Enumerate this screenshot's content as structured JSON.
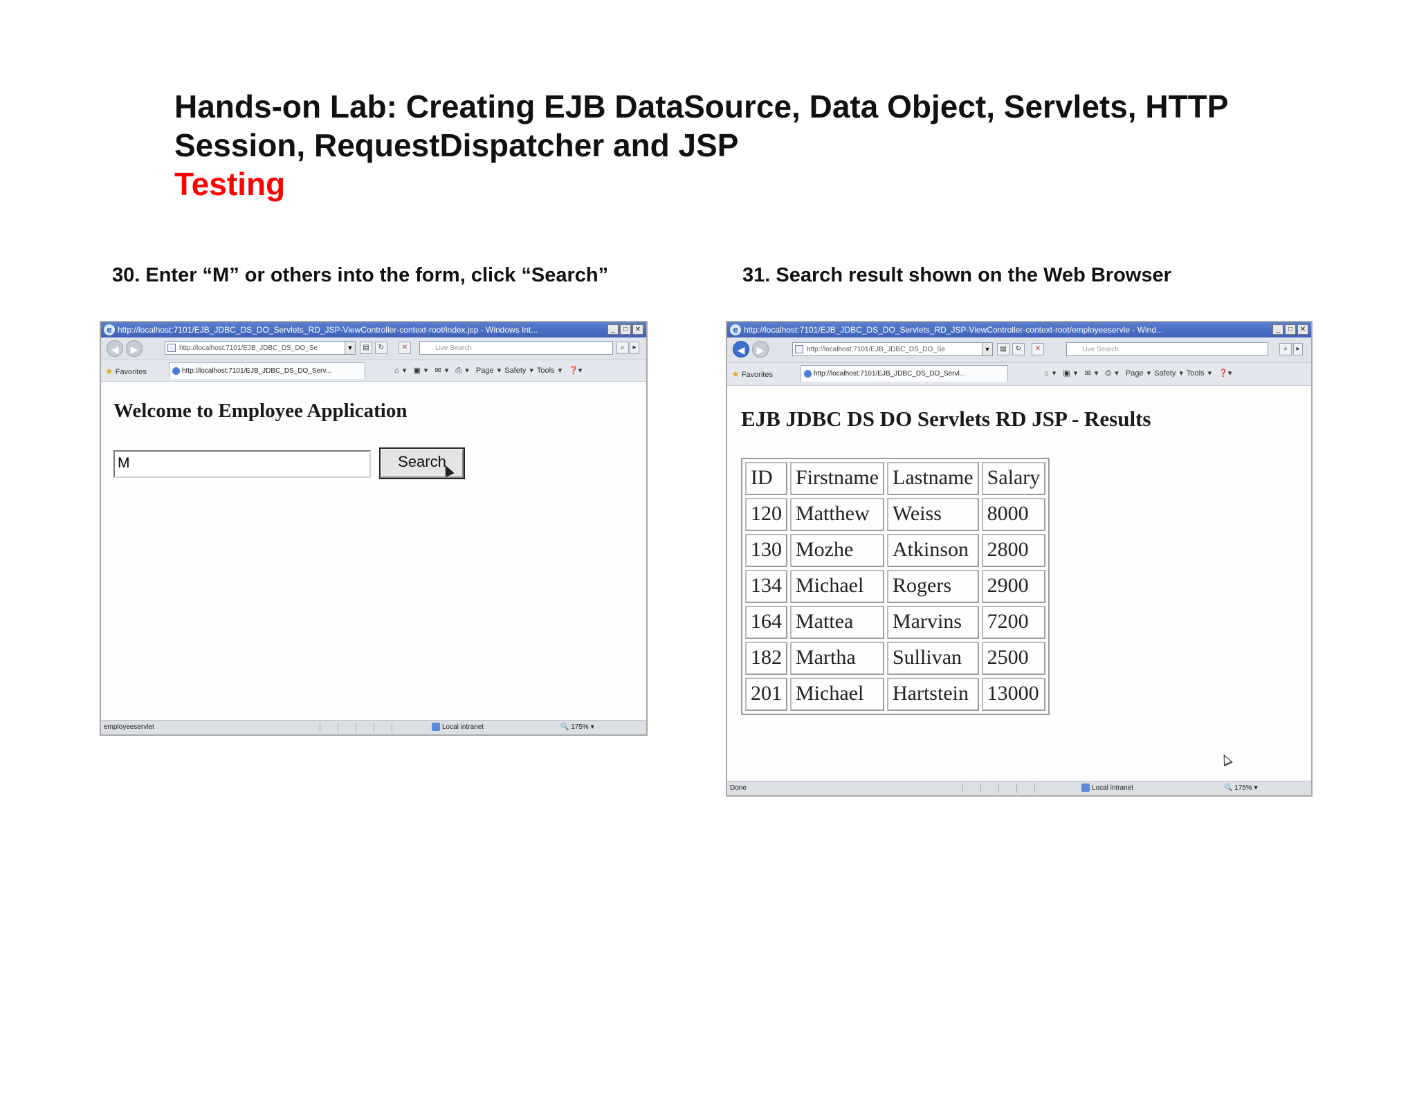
{
  "title": {
    "line1": "Hands-on Lab: Creating EJB DataSource, Data Object, Servlets, HTTP",
    "line2": "Session, RequestDispatcher and JSP",
    "subtitle": "Testing"
  },
  "steps": {
    "step30": "30. Enter “M” or others into the form, click “Search”",
    "step31": "31. Search result shown on the Web Browser"
  },
  "browser_left": {
    "window_title": "http://localhost:7101/EJB_JDBC_DS_DO_Servlets_RD_JSP-ViewController-context-root/index.jsp - Windows Int...",
    "address": "http://localhost:7101/EJB_JDBC_DS_DO_Se",
    "search_placeholder": "Live Search",
    "favorites_label": "Favorites",
    "tab_label": "http://localhost:7101/EJB_JDBC_DS_DO_Serv...",
    "tools_menu": "Page ▾   Safety ▾   Tools ▾",
    "status_left": "employeeservlet",
    "status_zone": "Local intranet",
    "status_zoom": "175%",
    "page_heading": "Welcome to Employee Application",
    "input_value": "M",
    "search_button": "Search"
  },
  "browser_right": {
    "window_title": "http://localhost:7101/EJB_JDBC_DS_DO_Servlets_RD_JSP-ViewController-context-root/employeeservle - Wind...",
    "address": "http://localhost:7101/EJB_JDBC_DS_DO_Se",
    "search_placeholder": "Live Search",
    "favorites_label": "Favorites",
    "tab_label": "http://localhost:7101/EJB_JDBC_DS_DO_Servl...",
    "tools_menu": "Page ▾   Safety ▾   Tools ▾",
    "status_left": "Done",
    "status_zone": "Local intranet",
    "status_zoom": "175%",
    "page_heading": "EJB JDBC DS DO Servlets RD JSP - Results",
    "table": {
      "headers": [
        "ID",
        "Firstname",
        "Lastname",
        "Salary"
      ],
      "rows": [
        [
          "120",
          "Matthew",
          "Weiss",
          "8000"
        ],
        [
          "130",
          "Mozhe",
          "Atkinson",
          "2800"
        ],
        [
          "134",
          "Michael",
          "Rogers",
          "2900"
        ],
        [
          "164",
          "Mattea",
          "Marvins",
          "7200"
        ],
        [
          "182",
          "Martha",
          "Sullivan",
          "2500"
        ],
        [
          "201",
          "Michael",
          "Hartstein",
          "13000"
        ]
      ]
    }
  }
}
